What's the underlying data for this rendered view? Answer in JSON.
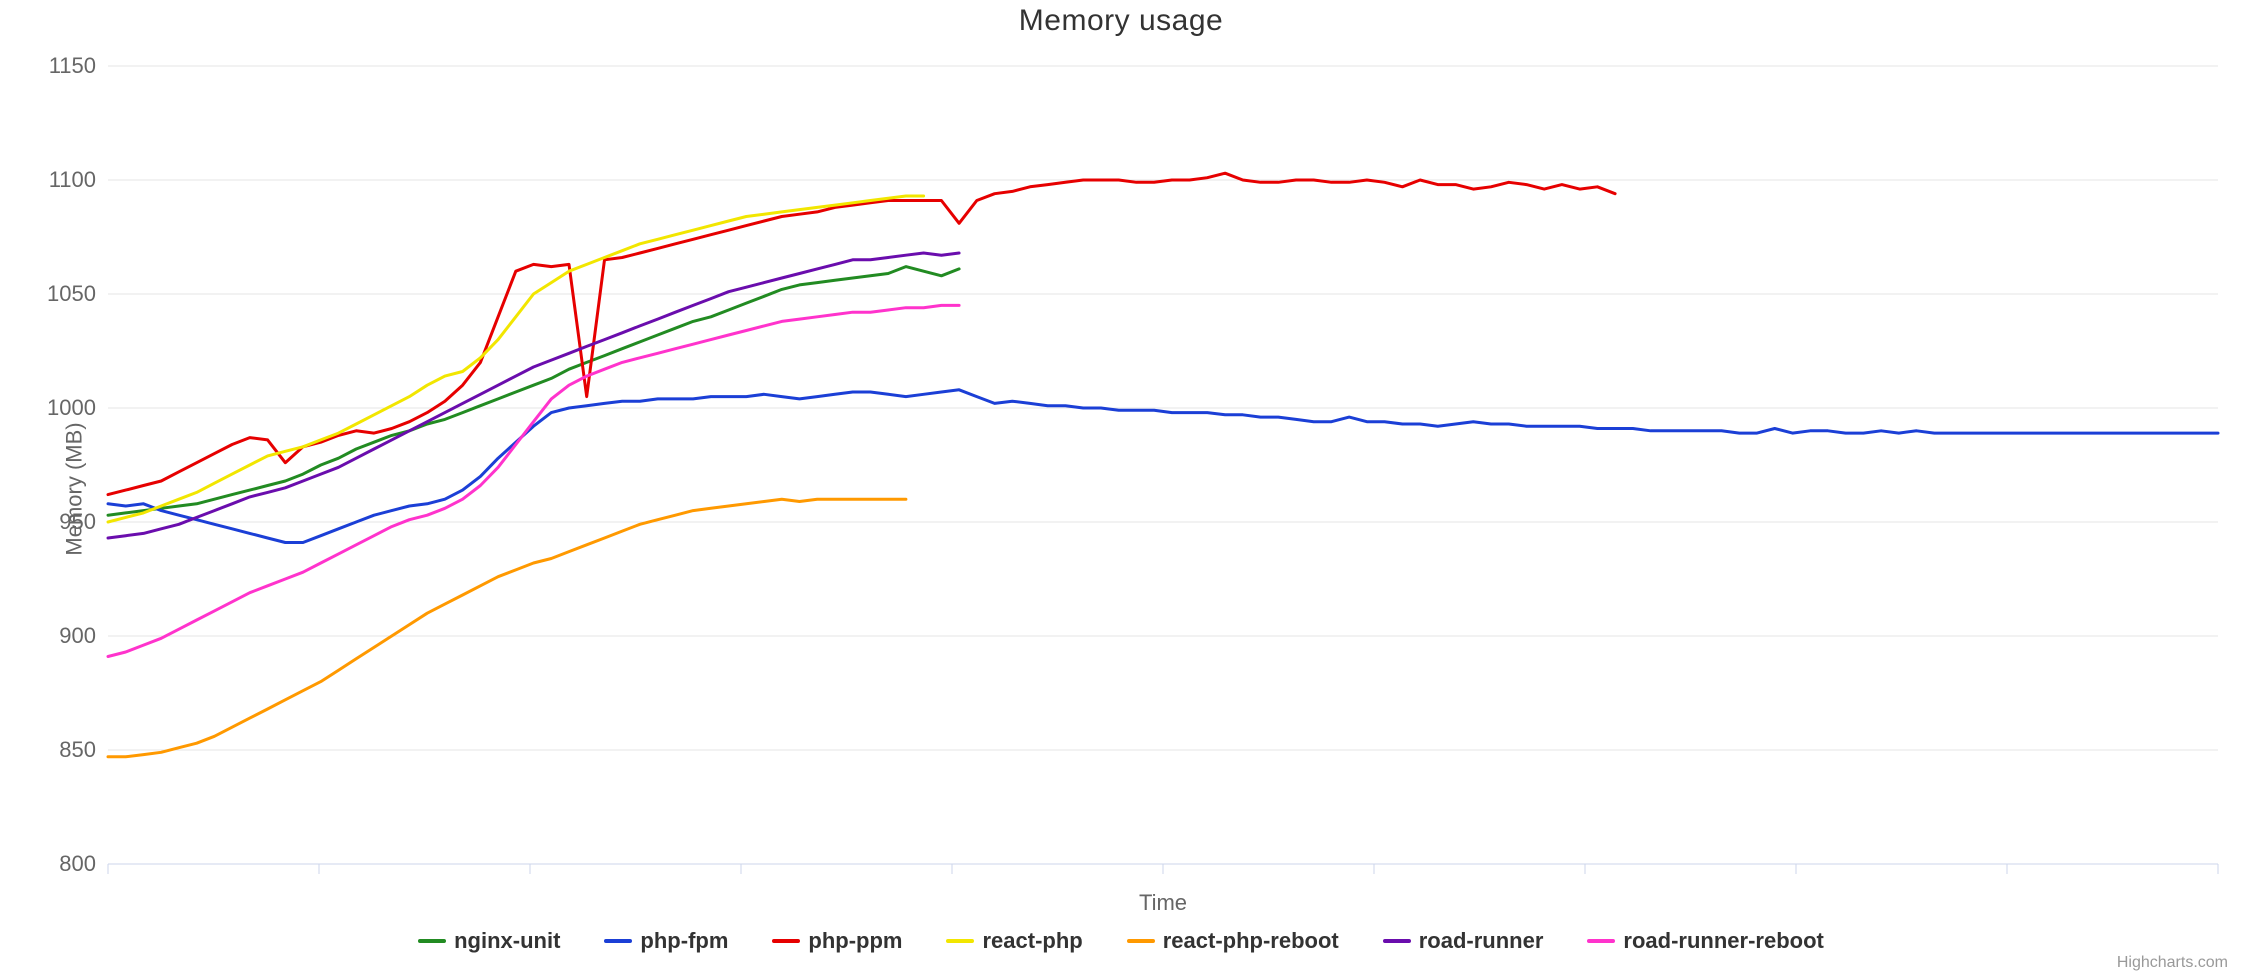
{
  "chart_data": {
    "type": "line",
    "title": "Memory usage",
    "xlabel": "Time",
    "ylabel": "Memory (MB)",
    "ylim": [
      800,
      1150
    ],
    "yticks": [
      800,
      850,
      900,
      950,
      1000,
      1050,
      1100,
      1150
    ],
    "x_count": 120,
    "series": [
      {
        "name": "nginx-unit",
        "color": "#228B22",
        "values": [
          953,
          954,
          955,
          956,
          957,
          958,
          960,
          962,
          964,
          966,
          968,
          971,
          975,
          978,
          982,
          985,
          988,
          990,
          993,
          995,
          998,
          1001,
          1004,
          1007,
          1010,
          1013,
          1017,
          1020,
          1023,
          1026,
          1029,
          1032,
          1035,
          1038,
          1040,
          1043,
          1046,
          1049,
          1052,
          1054,
          1055,
          1056,
          1057,
          1058,
          1059,
          1062,
          1060,
          1058,
          1061
        ]
      },
      {
        "name": "php-fpm",
        "color": "#1b3fd6",
        "values": [
          958,
          957,
          958,
          955,
          953,
          951,
          949,
          947,
          945,
          943,
          941,
          941,
          944,
          947,
          950,
          953,
          955,
          957,
          958,
          960,
          964,
          970,
          978,
          985,
          992,
          998,
          1000,
          1001,
          1002,
          1003,
          1003,
          1004,
          1004,
          1004,
          1005,
          1005,
          1005,
          1006,
          1005,
          1004,
          1005,
          1006,
          1007,
          1007,
          1006,
          1005,
          1006,
          1007,
          1008,
          1005,
          1002,
          1003,
          1002,
          1001,
          1001,
          1000,
          1000,
          999,
          999,
          999,
          998,
          998,
          998,
          997,
          997,
          996,
          996,
          995,
          994,
          994,
          996,
          994,
          994,
          993,
          993,
          992,
          993,
          994,
          993,
          993,
          992,
          992,
          992,
          992,
          991,
          991,
          991,
          990,
          990,
          990,
          990,
          990,
          989,
          989,
          991,
          989,
          990,
          990,
          989,
          989,
          990,
          989,
          990,
          989,
          989,
          989,
          989,
          989,
          989,
          989,
          989,
          989,
          989,
          989,
          989,
          989,
          989,
          989,
          989,
          989
        ]
      },
      {
        "name": "php-ppm",
        "color": "#e60000",
        "values": [
          962,
          964,
          966,
          968,
          972,
          976,
          980,
          984,
          987,
          986,
          976,
          983,
          985,
          988,
          990,
          989,
          991,
          994,
          998,
          1003,
          1010,
          1020,
          1040,
          1060,
          1063,
          1062,
          1063,
          1005,
          1065,
          1066,
          1068,
          1070,
          1072,
          1074,
          1076,
          1078,
          1080,
          1082,
          1084,
          1085,
          1086,
          1088,
          1089,
          1090,
          1091,
          1091,
          1091,
          1091,
          1081,
          1091,
          1094,
          1095,
          1097,
          1098,
          1099,
          1100,
          1100,
          1100,
          1099,
          1099,
          1100,
          1100,
          1101,
          1103,
          1100,
          1099,
          1099,
          1100,
          1100,
          1099,
          1099,
          1100,
          1099,
          1097,
          1100,
          1098,
          1098,
          1096,
          1097,
          1099,
          1098,
          1096,
          1098,
          1096,
          1097,
          1094
        ]
      },
      {
        "name": "react-php",
        "color": "#f2e600",
        "values": [
          950,
          952,
          954,
          957,
          960,
          963,
          967,
          971,
          975,
          979,
          981,
          983,
          986,
          989,
          993,
          997,
          1001,
          1005,
          1010,
          1014,
          1016,
          1022,
          1030,
          1040,
          1050,
          1055,
          1060,
          1063,
          1066,
          1069,
          1072,
          1074,
          1076,
          1078,
          1080,
          1082,
          1084,
          1085,
          1086,
          1087,
          1088,
          1089,
          1090,
          1091,
          1092,
          1093,
          1093
        ]
      },
      {
        "name": "react-php-reboot",
        "color": "#ff9900",
        "values": [
          847,
          847,
          848,
          849,
          851,
          853,
          856,
          860,
          864,
          868,
          872,
          876,
          880,
          885,
          890,
          895,
          900,
          905,
          910,
          914,
          918,
          922,
          926,
          929,
          932,
          934,
          937,
          940,
          943,
          946,
          949,
          951,
          953,
          955,
          956,
          957,
          958,
          959,
          960,
          959,
          960,
          960,
          960,
          960,
          960,
          960
        ]
      },
      {
        "name": "road-runner",
        "color": "#6a0dad",
        "values": [
          943,
          944,
          945,
          947,
          949,
          952,
          955,
          958,
          961,
          963,
          965,
          968,
          971,
          974,
          978,
          982,
          986,
          990,
          994,
          998,
          1002,
          1006,
          1010,
          1014,
          1018,
          1021,
          1024,
          1027,
          1030,
          1033,
          1036,
          1039,
          1042,
          1045,
          1048,
          1051,
          1053,
          1055,
          1057,
          1059,
          1061,
          1063,
          1065,
          1065,
          1066,
          1067,
          1068,
          1067,
          1068
        ]
      },
      {
        "name": "road-runner-reboot",
        "color": "#ff33cc",
        "values": [
          891,
          893,
          896,
          899,
          903,
          907,
          911,
          915,
          919,
          922,
          925,
          928,
          932,
          936,
          940,
          944,
          948,
          951,
          953,
          956,
          960,
          966,
          974,
          984,
          994,
          1004,
          1010,
          1014,
          1017,
          1020,
          1022,
          1024,
          1026,
          1028,
          1030,
          1032,
          1034,
          1036,
          1038,
          1039,
          1040,
          1041,
          1042,
          1042,
          1043,
          1044,
          1044,
          1045,
          1045
        ]
      }
    ]
  },
  "credits": "Highcharts.com"
}
